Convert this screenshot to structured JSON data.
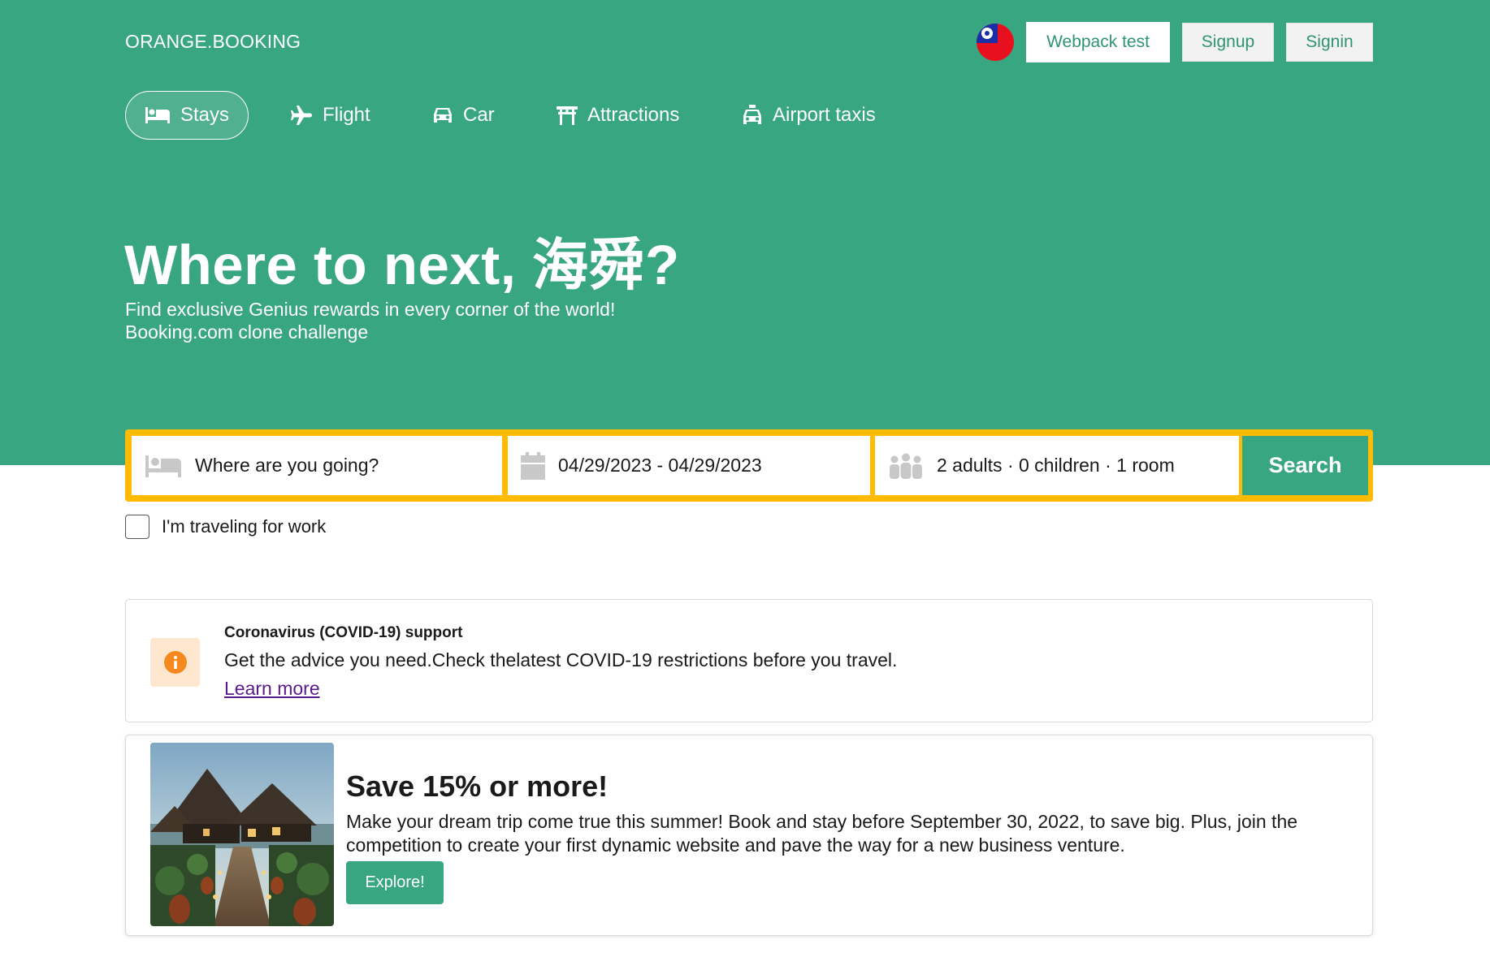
{
  "brand": {
    "logo": "ORANGE.BOOKING"
  },
  "header": {
    "webpack_label": "Webpack test",
    "signup_label": "Signup",
    "signin_label": "Signin"
  },
  "nav": {
    "items": [
      {
        "label": "Stays",
        "icon": "bed-icon",
        "active": true
      },
      {
        "label": "Flight",
        "icon": "plane-icon",
        "active": false
      },
      {
        "label": "Car",
        "icon": "car-icon",
        "active": false
      },
      {
        "label": "Attractions",
        "icon": "torii-gate-icon",
        "active": false
      },
      {
        "label": "Airport taxis",
        "icon": "taxi-icon",
        "active": false
      }
    ]
  },
  "hero": {
    "headline": "Where to next, 海舜?",
    "subtitle_1": "Find exclusive Genius rewards in every corner of the world!",
    "subtitle_2": "Booking.com clone challenge"
  },
  "search": {
    "destination_placeholder": "Where are you going?",
    "dates": "04/29/2023 - 04/29/2023",
    "guests": "2 adults · 0 children · 1 room",
    "button_label": "Search",
    "work_checkbox_label": "I'm traveling for work",
    "work_checked": false
  },
  "covid": {
    "title": "Coronavirus (COVID-19) support",
    "message": "Get the advice you need.Check thelatest COVID-19 restrictions before you travel.",
    "link_label": "Learn more"
  },
  "promo": {
    "title": "Save 15% or more!",
    "description": "Make your dream trip come true this summer! Book and stay before September 30, 2022, to save big. Plus, join the competition to create your first dynamic website and pave the way for a new business venture.",
    "button_label": "Explore!"
  },
  "colors": {
    "brand_green": "#38a680",
    "search_border": "#febb02",
    "info_orange": "#f5891f",
    "link_purple": "#5b1a8b"
  }
}
